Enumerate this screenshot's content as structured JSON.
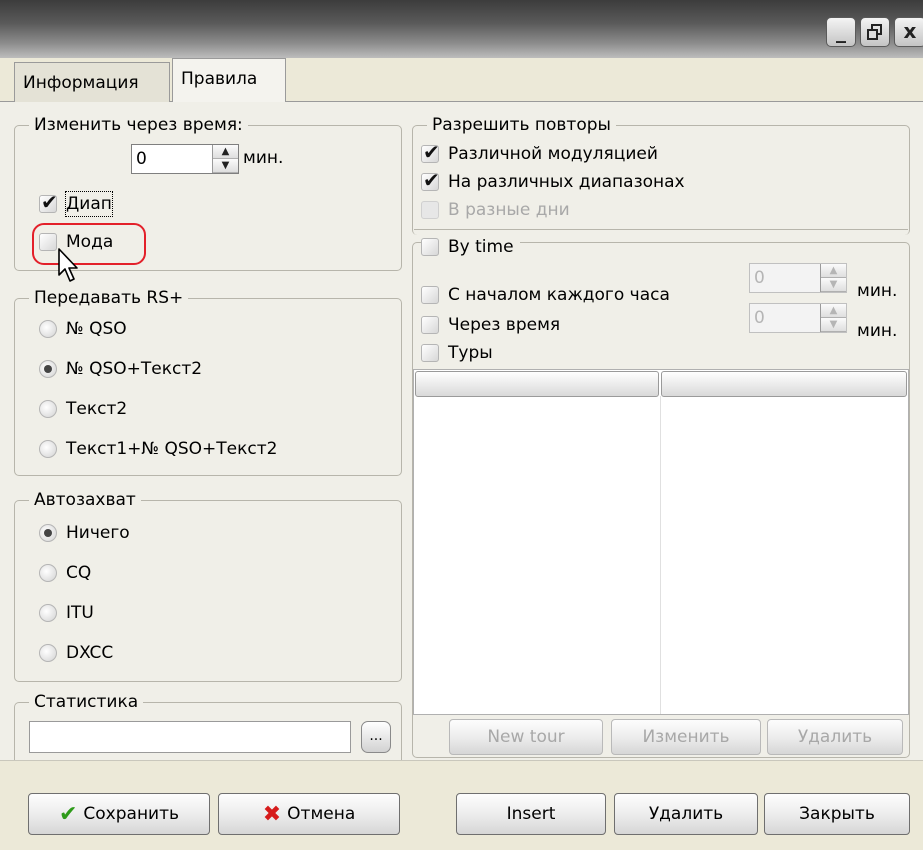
{
  "window": {
    "controls": {
      "minimize": "_",
      "restore": "đ",
      "close": "x"
    }
  },
  "tabs": [
    {
      "label": "Информация"
    },
    {
      "label": "Правила"
    }
  ],
  "change_after_time": {
    "legend": "Изменить через время:",
    "value": "0",
    "unit": "мин.",
    "band_label": "Диап",
    "band_checked": true,
    "mode_label": "Мода",
    "mode_checked": false
  },
  "send_rs": {
    "legend": "Передавать RS+",
    "options": [
      {
        "label": "№ QSO",
        "selected": false
      },
      {
        "label": "№ QSO+Текст2",
        "selected": true
      },
      {
        "label": "Текст2",
        "selected": false
      },
      {
        "label": "Текст1+№ QSO+Текст2",
        "selected": false
      }
    ]
  },
  "autocapture": {
    "legend": "Автозахват",
    "options": [
      {
        "label": "Ничего",
        "selected": true
      },
      {
        "label": "CQ",
        "selected": false
      },
      {
        "label": "ITU",
        "selected": false
      },
      {
        "label": "DXCC",
        "selected": false
      }
    ]
  },
  "statistics": {
    "legend": "Статистика",
    "value": "",
    "browse_label": "..."
  },
  "allow_repeats": {
    "legend": "Разрешить повторы",
    "options": [
      {
        "label": "Различной модуляцией",
        "checked": true,
        "disabled": false
      },
      {
        "label": "На различных диапазонах",
        "checked": true,
        "disabled": false
      },
      {
        "label": "В разные дни",
        "checked": false,
        "disabled": true
      }
    ]
  },
  "by_time": {
    "label": "By time",
    "hourly_label": "С началом каждого часа",
    "hourly_value": "0",
    "hourly_unit": "мин.",
    "after_label": "Через время",
    "after_value": "0",
    "after_unit": "мин.",
    "tours_label": "Туры",
    "columns": [
      "",
      ""
    ],
    "buttons": {
      "new_tour": "New tour",
      "edit": "Изменить",
      "delete": "Удалить"
    }
  },
  "footer": {
    "save": "Сохранить",
    "cancel": "Отмена",
    "insert": "Insert",
    "delete": "Удалить",
    "close": "Закрыть"
  },
  "colors": {
    "highlight": "#e3202a",
    "save_icon": "#2e9b1a",
    "cancel_icon": "#d61b1b"
  }
}
